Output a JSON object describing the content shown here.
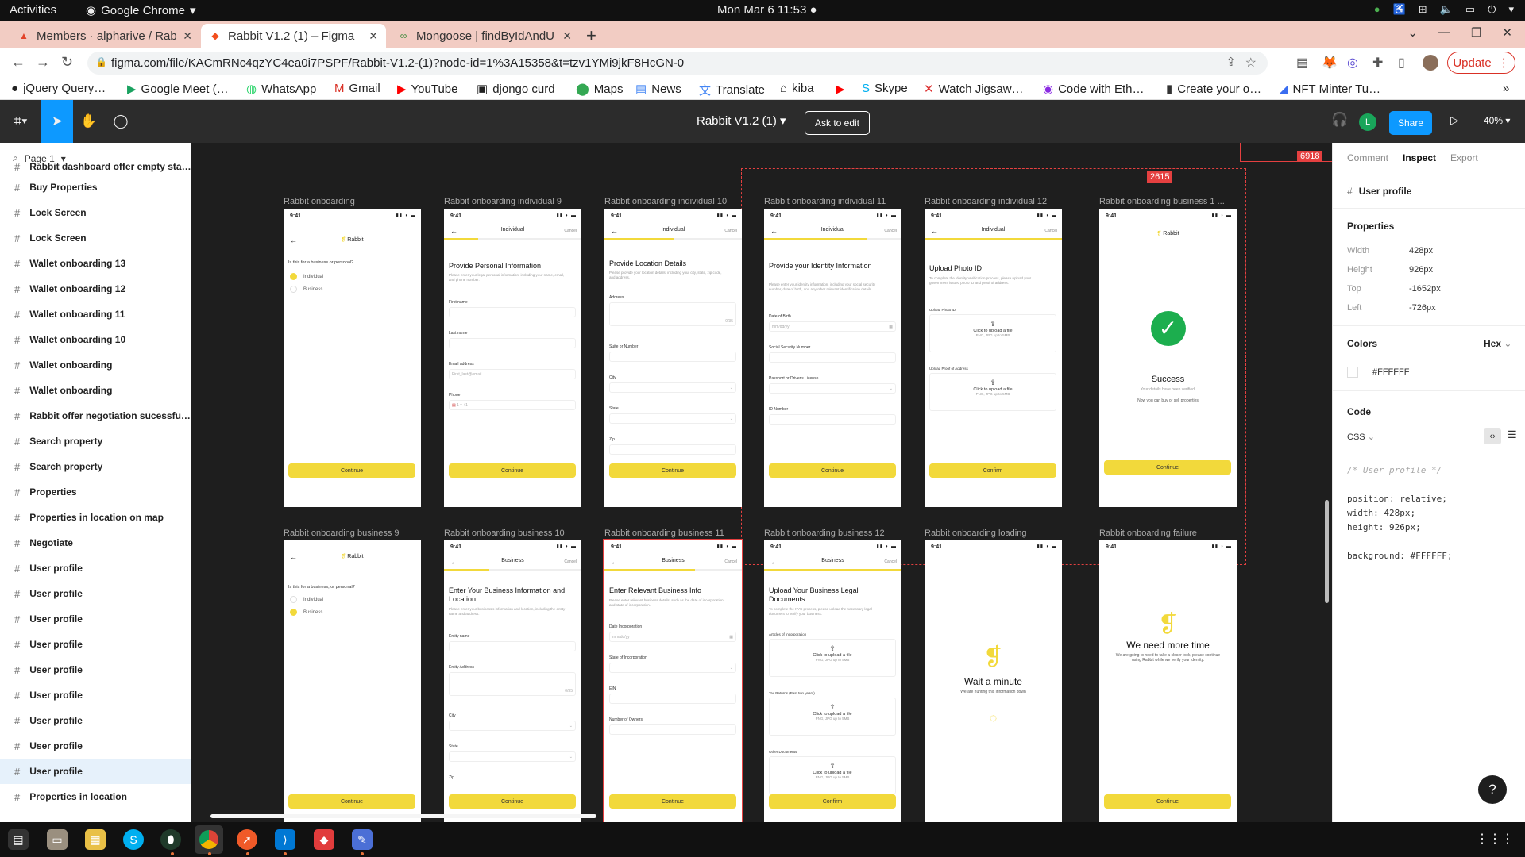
{
  "gnome": {
    "activities": "Activities",
    "app_menu": "Google Chrome",
    "clock": "Mon Mar 6  11:53"
  },
  "tabs": [
    {
      "title": "Members · alpharive / Rab",
      "icon": "gitlab-icon"
    },
    {
      "title": "Rabbit V1.2 (1) – Figma",
      "icon": "figma-icon"
    },
    {
      "title": "Mongoose | findByIdAndU",
      "icon": "mongoose-icon"
    }
  ],
  "address": {
    "url": "figma.com/file/KACmRNc4qzYC4ea0i7PSPF/Rabbit-V1.2-(1)?node-id=1%3A15358&t=tzv1YMi9jkF8HcGN-0",
    "update": "Update"
  },
  "bookmarks": [
    "jQuery Query…",
    "Google Meet (…",
    "WhatsApp",
    "Gmail",
    "YouTube",
    "djongo curd",
    "Maps",
    "News",
    "Translate",
    "kiba",
    "",
    "Skype",
    "Watch Jigsaw…",
    "Code with Eth…",
    "Create your o…",
    "NFT Minter Tu…"
  ],
  "figma": {
    "file_title": "Rabbit V1.2 (1)",
    "ask_to_edit": "Ask to edit",
    "avatar": "L",
    "share": "Share",
    "zoom": "40%",
    "page": "Page 1"
  },
  "layers": [
    "Rabbit dashboard offer empty sta…",
    "Buy Properties",
    "Lock Screen",
    "Lock Screen",
    "Wallet onboarding 13",
    "Wallet onboarding 12",
    "Wallet onboarding 11",
    "Wallet onboarding 10",
    "Wallet onboarding",
    "Wallet onboarding",
    "Rabbit offer negotiation sucessfu…",
    "Search property",
    "Search property",
    "Properties",
    "Properties in location on map",
    "Negotiate",
    "User profile",
    "User profile",
    "User profile",
    "User profile",
    "User profile",
    "User profile",
    "User profile",
    "User profile",
    "User profile",
    "Properties in location"
  ],
  "canvas": {
    "badge_a": "6918",
    "badge_b": "2615",
    "frame_labels": [
      "Rabbit onboarding",
      "Rabbit onboarding individual 9",
      "Rabbit onboarding individual 10",
      "Rabbit onboarding individual 11",
      "Rabbit onboarding individual 12",
      "Rabbit onboarding business 1 ...",
      "Rabbit onboarding business 9",
      "Rabbit onboarding business 10",
      "Rabbit onboarding business 11",
      "Rabbit onboarding business 12",
      "Rabbit onboarding loading",
      "Rabbit onboarding failure"
    ],
    "time": "9:41",
    "brand": "Rabbit",
    "individual": "Individual",
    "business": "Business",
    "cancel": "Cancel",
    "q_business_personal": "Is this for a business or personal?",
    "q_business_personal2": "Is this for a business, or personal?",
    "continue": "Continue",
    "confirm": "Confirm",
    "personal_title": "Provide Personal Information",
    "personal_desc": "Please enter your legal personal information, including your name, email, and phone number.",
    "first_name": "First name",
    "last_name": "Last name",
    "email": "Email address",
    "email_ph": "First_last@email",
    "phone": "Phone",
    "phone_code": "+1",
    "location_title": "Provide Location Details",
    "location_desc": "Please provide your location details, including your city, state, zip code, and address.",
    "address": "Address",
    "suite": "Suite or Number",
    "city": "City",
    "state": "State",
    "zip": "Zip",
    "counter": "0/35",
    "identity_title": "Provide your Identity Information",
    "identity_desc": "Please enter your identity information, including your social security number, date of birth, and any other relevant identification details.",
    "dob": "Date of Birth",
    "dob_ph": "mm/dd/yy",
    "ssn": "Social Security Number",
    "passport": "Passport  or Driver's License",
    "id_number": "ID Number",
    "photo_title": "Upload Photo ID",
    "photo_desc": "To complete the identity Verification process, please upload your government issued photo ID and proof of address.",
    "upload_photo_id": "Upload Photo ID",
    "upload_proof": "Upload Proof of Address",
    "click_upload": "Click to upload a file",
    "upload_hint": "PNG, JPG up to 5MB",
    "success": "Success",
    "success_sub": "Your details have been verified!",
    "success_sub2": "Now you can buy or sell properties",
    "biz_info_title": "Enter Your Business Information and Location",
    "biz_info_desc": "Please enter your business's information and location, including the entity name and address.",
    "entity_name": "Entity name",
    "entity_address": "Entity Address",
    "relevant_title": "Enter Relevant Business Info",
    "relevant_desc": "Please enter relevant business details, such as the date of incorporation and state of incorporation.",
    "date_inc": "Date Incorporation",
    "state_inc": "State of Incorporation",
    "ein": "EIN",
    "owners": "Number of Owners",
    "legal_title": "Upload Your Business Legal Documents",
    "legal_desc": "To complete the KYC process, please upload the necessary legal document to verify your business.",
    "articles": "Articles of Incorporation",
    "tax": "Tax Returns (Past two years)",
    "other_docs": "Other Documents",
    "wait": "Wait a minute",
    "wait_sub": "We are hunting this information down",
    "need_time": "We need more time",
    "need_time_sub": "We are going to need to take a closer look, please continue using Rabbit while we verify your identity."
  },
  "inspect": {
    "tabs": [
      "Comment",
      "Inspect",
      "Export"
    ],
    "layer": "User profile",
    "properties": "Properties",
    "props": [
      {
        "k": "Width",
        "v": "428px"
      },
      {
        "k": "Height",
        "v": "926px"
      },
      {
        "k": "Top",
        "v": "-1652px"
      },
      {
        "k": "Left",
        "v": "-726px"
      }
    ],
    "colors": "Colors",
    "color_mode": "Hex",
    "color_value": "#FFFFFF",
    "code": "Code",
    "lang": "CSS",
    "code_lines": [
      "/* User profile */",
      "",
      "position: relative;",
      "width: 428px;",
      "height: 926px;",
      "",
      "background: #FFFFFF;"
    ]
  },
  "colors": {
    "accent": "#f2d93b",
    "figma_blue": "#0d99ff",
    "selection": "#e54040",
    "success": "#1cae4e"
  }
}
